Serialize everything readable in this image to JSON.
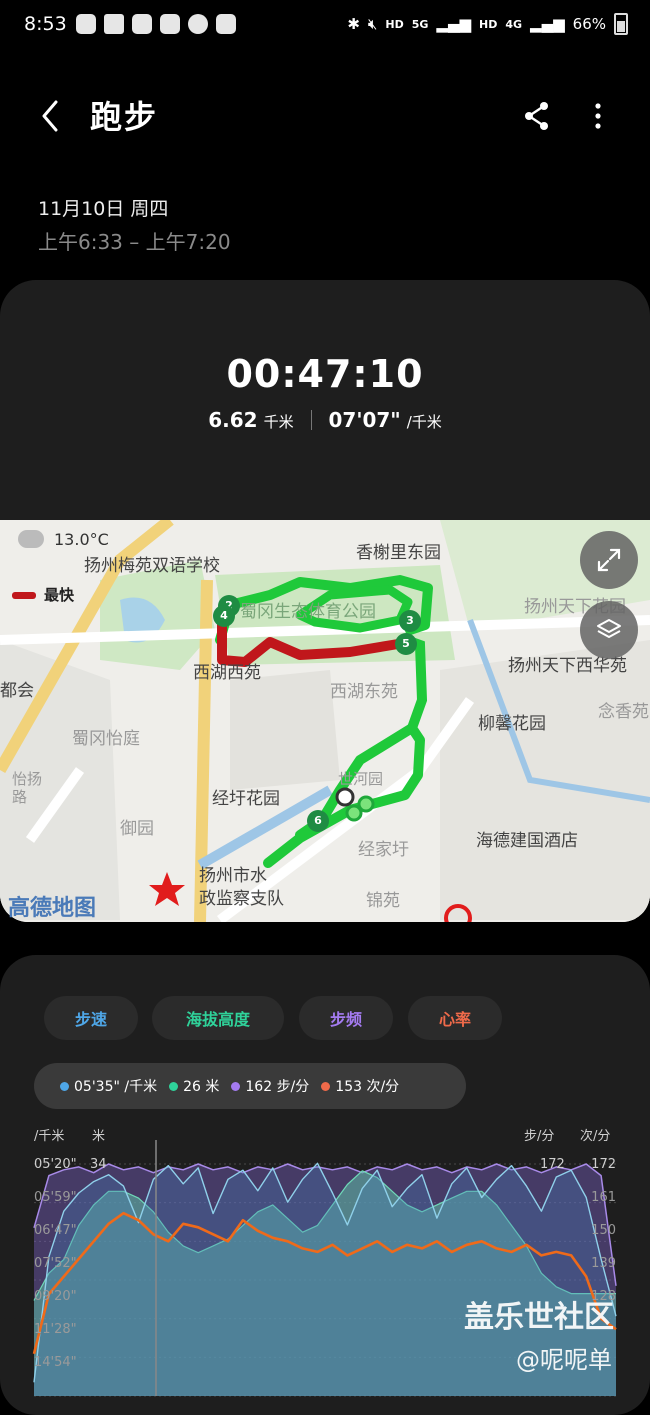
{
  "status_bar": {
    "time": "8:53",
    "net1": "HD",
    "net2": "5G",
    "net3": "HD",
    "net4": "4G",
    "battery": "66%"
  },
  "header": {
    "title": "跑步",
    "date": "11月10日 周四",
    "time_range": "上午6:33 – 上午7:20"
  },
  "summary": {
    "duration": "00:47:10",
    "distance": "6.62",
    "distance_unit": "千米",
    "pace": "07'07\"",
    "pace_unit": "/千米"
  },
  "map": {
    "temperature": "13.0°C",
    "legend_fastest": "最快",
    "provider_logo": "高德地图",
    "labels": [
      "扬州梅苑双语学校",
      "香榭里东园",
      "扬州天下花园",
      "蜀冈生态体育公园",
      "西湖西苑",
      "西湖东苑",
      "扬州天下西华苑",
      "都会",
      "蜀冈怡庭",
      "柳馨花园",
      "念香苑",
      "怡扬路",
      "经圩花园",
      "御园",
      "世河园",
      "经家圩",
      "海德建国酒店",
      "扬州市水",
      "政监察支队",
      "锦苑"
    ],
    "km_markers": [
      "2",
      "4",
      "3",
      "5",
      "6"
    ],
    "colors": {
      "route": "#1fc93a",
      "fastest": "#c0171b"
    }
  },
  "chart_tabs": [
    {
      "label": "步速",
      "color": "#4fa7e8"
    },
    {
      "label": "海拔高度",
      "color": "#2fd29a"
    },
    {
      "label": "步频",
      "color": "#a47bf0"
    },
    {
      "label": "心率",
      "color": "#ef6a4a"
    }
  ],
  "tooltip": {
    "pace": "05'35\"",
    "pace_unit": "/千米",
    "altitude": "26",
    "altitude_unit": "米",
    "cadence": "162",
    "cadence_unit": "步/分",
    "heart_rate": "153",
    "heart_rate_unit": "次/分"
  },
  "chart_axes": {
    "pace_unit": "/千米",
    "alt_unit": "米",
    "cadence_unit": "步/分",
    "hr_unit": "次/分",
    "pace_ticks": [
      "05'20\"",
      "05'59\"",
      "06'47\"",
      "07'52\"",
      "09'20\"",
      "11'28\"",
      "14'54\""
    ],
    "alt_top": "34",
    "cadence_top": "172",
    "hr_ticks": [
      "172",
      "161",
      "150",
      "139",
      "128"
    ]
  },
  "watermark": {
    "line1": "盖乐世社区",
    "line2": "@呢呢单"
  },
  "chart_data": {
    "type": "line",
    "x_label": "",
    "series": [
      {
        "name": "步速",
        "unit": "/千米",
        "values": [
          14.9,
          9.4,
          7.4,
          6.6,
          6.1,
          5.8,
          6.3,
          7.9,
          6.0,
          5.4,
          6.2,
          5.5,
          7.5,
          6.0,
          5.6,
          6.5,
          5.5,
          7.0,
          6.0,
          5.3,
          6.6,
          8.0,
          6.4,
          5.6,
          7.2,
          6.4,
          5.8,
          7.7,
          6.2,
          5.5,
          6.8,
          6.0,
          5.4,
          6.3,
          7.4,
          5.9,
          5.6,
          6.8,
          9.5,
          12.0
        ]
      },
      {
        "name": "海拔高度",
        "unit": "米",
        "values": [
          14,
          18,
          20,
          25,
          28,
          30,
          30,
          29,
          27,
          24,
          22,
          21,
          22,
          23,
          25,
          27,
          28,
          26,
          24,
          25,
          28,
          31,
          33,
          32,
          30,
          28,
          27,
          28,
          29,
          30,
          30,
          28,
          25,
          22,
          18,
          16,
          15,
          15,
          15,
          15
        ]
      },
      {
        "name": "步频",
        "unit": "步/分",
        "values": [
          150,
          168,
          170,
          171,
          169,
          172,
          170,
          171,
          169,
          171,
          170,
          172,
          170,
          171,
          169,
          171,
          170,
          172,
          170,
          171,
          170,
          171,
          169,
          171,
          170,
          172,
          170,
          171,
          169,
          171,
          170,
          172,
          170,
          171,
          169,
          171,
          170,
          172,
          168,
          130
        ]
      },
      {
        "name": "心率",
        "unit": "次/分",
        "values": [
          118,
          135,
          140,
          145,
          150,
          155,
          158,
          156,
          152,
          150,
          155,
          154,
          152,
          150,
          156,
          153,
          151,
          150,
          148,
          147,
          149,
          146,
          148,
          150,
          147,
          149,
          148,
          150,
          147,
          149,
          150,
          148,
          147,
          149,
          146,
          147,
          146,
          140,
          128,
          125
        ]
      }
    ]
  }
}
